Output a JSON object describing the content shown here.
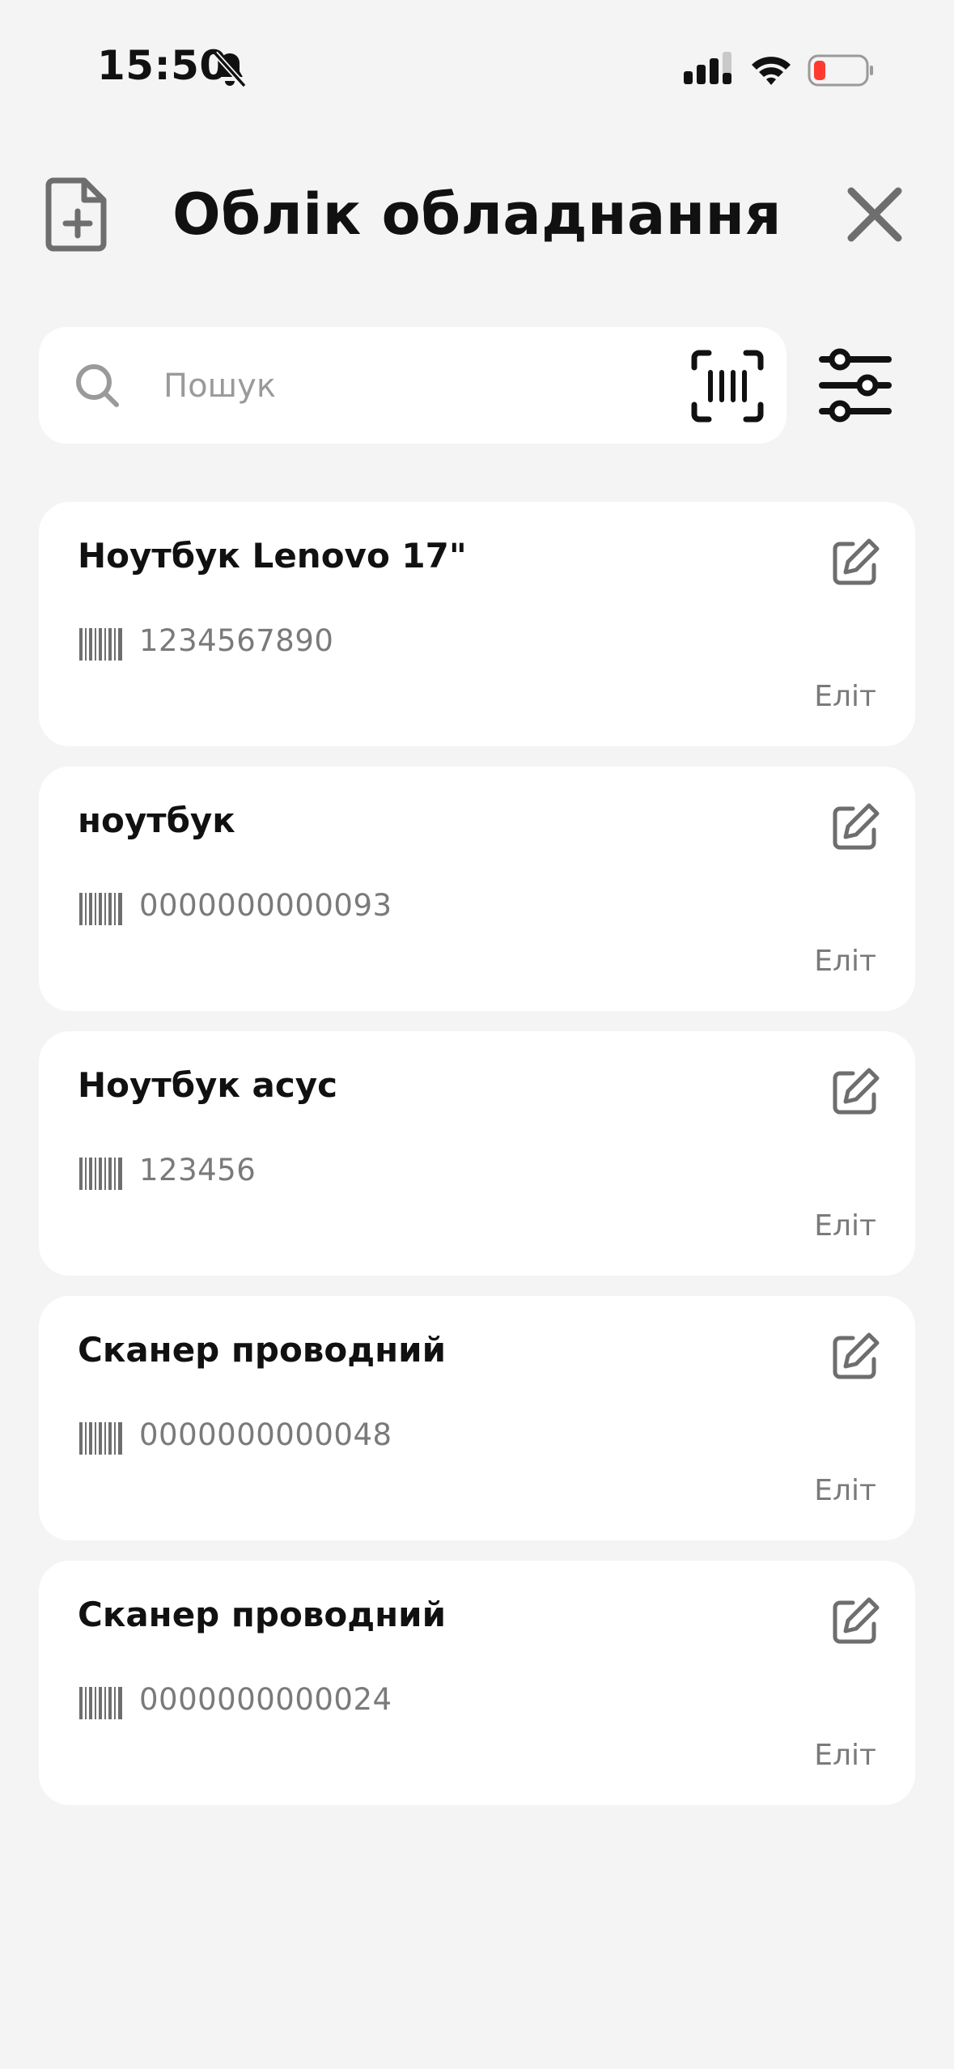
{
  "status_bar": {
    "time": "15:50",
    "icons": [
      "bell-off-icon",
      "signal-icon",
      "wifi-icon",
      "battery-low-icon"
    ],
    "battery_color": "#ff3b30"
  },
  "header": {
    "title": "Облік обладнання",
    "add_icon": "file-plus-icon",
    "close_icon": "close-icon"
  },
  "search": {
    "placeholder": "Пошук",
    "value": "",
    "scan_icon": "barcode-scan-icon",
    "filter_icon": "sliders-icon"
  },
  "items": [
    {
      "title": "Ноутбук Lenovo 17\"",
      "code": "1234567890",
      "location": "Еліт"
    },
    {
      "title": "ноутбук",
      "code": "0000000000093",
      "location": "Еліт"
    },
    {
      "title": "Ноутбук асус",
      "code": "123456",
      "location": "Еліт"
    },
    {
      "title": "Сканер проводний",
      "code": "0000000000048",
      "location": "Еліт"
    },
    {
      "title": "Сканер проводний",
      "code": "0000000000024",
      "location": "Еліт"
    }
  ],
  "colors": {
    "background": "#f4f4f4",
    "card": "#ffffff",
    "muted_text": "#7a7a7a",
    "icon_gray": "#6e6e6e"
  }
}
